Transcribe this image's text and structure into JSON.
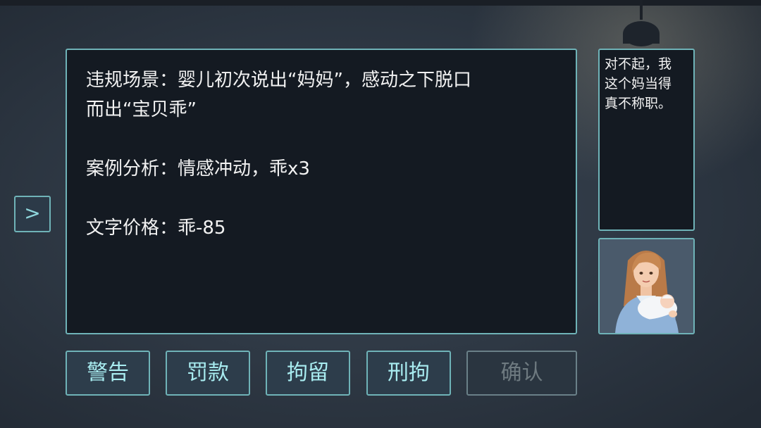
{
  "case": {
    "scene": "违规场景：婴儿初次说出“妈妈”，感动之下脱口",
    "scene_cont": "而出“宝贝乖”",
    "analysis": "案例分析：情感冲动，乖x3",
    "price": "文字价格：乖-85"
  },
  "speech": {
    "line1": "对不起，我",
    "line2": "这个妈当得",
    "line3": "真不称职。"
  },
  "nav": {
    "arrow": ">"
  },
  "buttons": {
    "warn": "警告",
    "fine": "罚款",
    "detain": "拘留",
    "criminal_detain": "刑拘",
    "confirm": "确认"
  },
  "colors": {
    "accent": "#6fb3b8",
    "button_text": "#a8ecf0",
    "disabled_text": "#6e7a80"
  },
  "icons": {
    "portrait": "mother-with-baby-portrait",
    "lamp": "ceiling-lamp"
  }
}
